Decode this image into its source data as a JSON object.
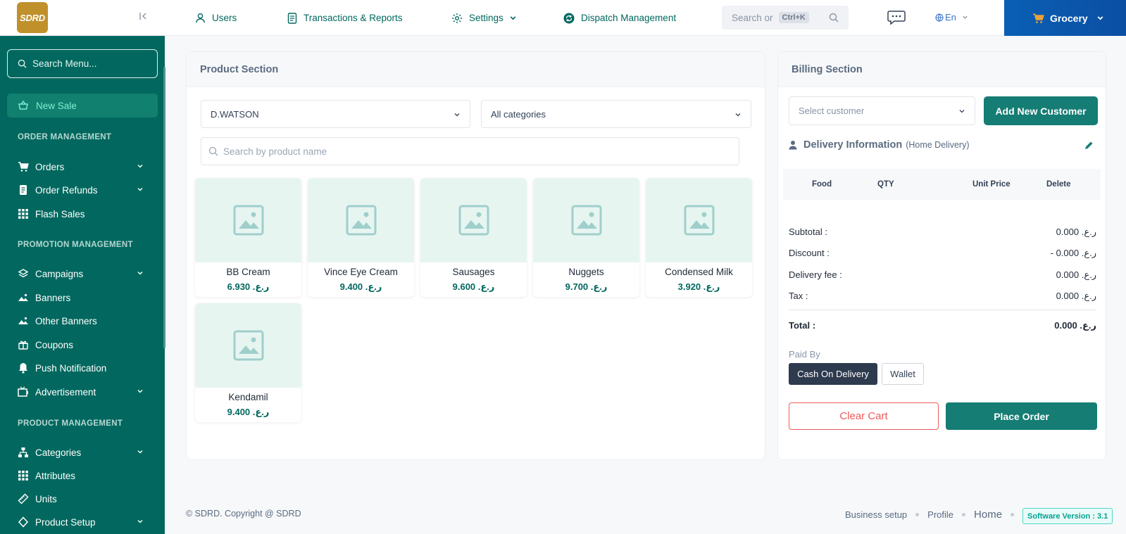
{
  "sidebar": {
    "logo_text": "SDRD",
    "search_placeholder": "Search Menu...",
    "active_item": "New Sale",
    "sections": [
      {
        "title": "ORDER MANAGEMENT",
        "items": [
          "Orders",
          "Order Refunds",
          "Flash Sales"
        ]
      },
      {
        "title": "PROMOTION MANAGEMENT",
        "items": [
          "Campaigns",
          "Banners",
          "Other Banners",
          "Coupons",
          "Push Notification",
          "Advertisement"
        ]
      },
      {
        "title": "PRODUCT MANAGEMENT",
        "items": [
          "Categories",
          "Attributes",
          "Units",
          "Product Setup"
        ]
      }
    ]
  },
  "topbar": {
    "nav": [
      "Users",
      "Transactions & Reports",
      "Settings",
      "Dispatch Management"
    ],
    "search_placeholder": "Search or",
    "search_shortcut": "Ctrl+K",
    "language": "En",
    "store": "Grocery"
  },
  "product_section": {
    "title": "Product Section",
    "store_select": "D.WATSON",
    "category_select": "All categories",
    "search_placeholder": "Search by product name",
    "products": [
      {
        "name": "BB Cream",
        "price": "6.930 .ر.ع"
      },
      {
        "name": "Vince Eye Cream",
        "price": "9.400 .ر.ع"
      },
      {
        "name": "Sausages",
        "price": "9.600 .ر.ع"
      },
      {
        "name": "Nuggets",
        "price": "9.700 .ر.ع"
      },
      {
        "name": "Condensed Milk",
        "price": "3.920 .ر.ع"
      },
      {
        "name": "Kendamil",
        "price": "9.400 .ر.ع"
      }
    ]
  },
  "billing": {
    "title": "Billing Section",
    "customer_placeholder": "Select customer",
    "add_customer": "Add New Customer",
    "delivery_title": "Delivery Information",
    "delivery_type": "(Home Delivery)",
    "table_headers": [
      "Food",
      "QTY",
      "Unit Price",
      "Delete"
    ],
    "subtotal_label": "Subtotal :",
    "subtotal": "0.000 .ر.ع",
    "discount_label": "Discount :",
    "discount": "- 0.000 .ر.ع",
    "delivery_fee_label": "Delivery fee :",
    "delivery_fee": "0.000 .ر.ع",
    "tax_label": "Tax :",
    "tax": "0.000 .ر.ع",
    "total_label": "Total :",
    "total": "0.000 .ر.ع",
    "paid_by": "Paid By",
    "pay_cod": "Cash On Delivery",
    "pay_wallet": "Wallet",
    "clear_cart": "Clear Cart",
    "place_order": "Place Order"
  },
  "footer": {
    "copyright": "© SDRD. Copyright @ SDRD",
    "links": [
      "Business setup",
      "Profile",
      "Home"
    ],
    "version": "Software Version : 3.1"
  },
  "colors": {
    "primary": "#02685f",
    "accent": "#157d74",
    "danger": "#ee5b5b",
    "store_blue": "#0b4fa3"
  }
}
